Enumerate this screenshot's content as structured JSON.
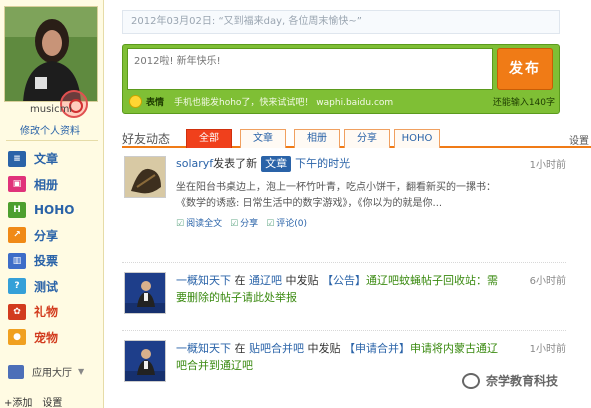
{
  "profile": {
    "username": "musicmi",
    "edit_link": "修改个人资料"
  },
  "sidebar": {
    "items": [
      {
        "label": "文章",
        "icon": "article-icon",
        "color": "#2a63a8"
      },
      {
        "label": "相册",
        "icon": "album-icon",
        "color": "#e0327a"
      },
      {
        "label": "HOHO",
        "icon": "hoho-icon",
        "color": "#4d9f2f"
      },
      {
        "label": "分享",
        "icon": "share-icon",
        "color": "#f08a16"
      },
      {
        "label": "投票",
        "icon": "vote-icon",
        "color": "#3d6dc8"
      },
      {
        "label": "测试",
        "icon": "test-icon",
        "color": "#35a0d8"
      },
      {
        "label": "礼物",
        "icon": "gift-icon",
        "color": "#d23b1e"
      },
      {
        "label": "宠物",
        "icon": "pet-icon",
        "color": "#f0a020"
      }
    ],
    "app_hall": "应用大厅",
    "bottom_add": "+添加",
    "bottom_settings": "设置"
  },
  "composer": {
    "previous_status": "2012年03月02日: “又到福来day, 各位周末愉快~”",
    "placeholder": "2012啦! 新年快乐!",
    "publish_label": "发布",
    "emoji_label": "表情",
    "promo": "手机也能发hoho了，快来试试吧！ waphi.baidu.com",
    "char_count": "还能输入140字"
  },
  "feed": {
    "label": "好友动态",
    "settings": "设置",
    "tabs": [
      "全部",
      "文章",
      "相册",
      "分享",
      "HOHO"
    ],
    "items": [
      {
        "user": "solaryf",
        "action": "发表了新",
        "type": "文章",
        "title": "下午的时光",
        "time": "1小时前",
        "excerpt": "坐在阳台书桌边上，泡上一杯竹叶青，吃点小饼干，翻看新买的一摞书：《数学的诱惑: 日常生活中的数字游戏》，《你以为的就是你...",
        "actions": [
          "阅读全文",
          "分享",
          "评论(0)"
        ]
      },
      {
        "user": "一概知天下",
        "prep": "在",
        "forum": "通辽吧",
        "action": "中发贴",
        "bracket": "【公告】",
        "subject": "通辽吧蚊蝇帖子回收站：需要删除的帖子请此处举报",
        "time": "6小时前"
      },
      {
        "user": "一概知天下",
        "prep": "在",
        "forum": "贴吧合并吧",
        "action": "中发贴",
        "bracket": "【申请合并】",
        "subject": "申请将内蒙古通辽吧合并到通辽吧",
        "time": "1小时前"
      }
    ]
  },
  "watermark": "奈学教育科技"
}
